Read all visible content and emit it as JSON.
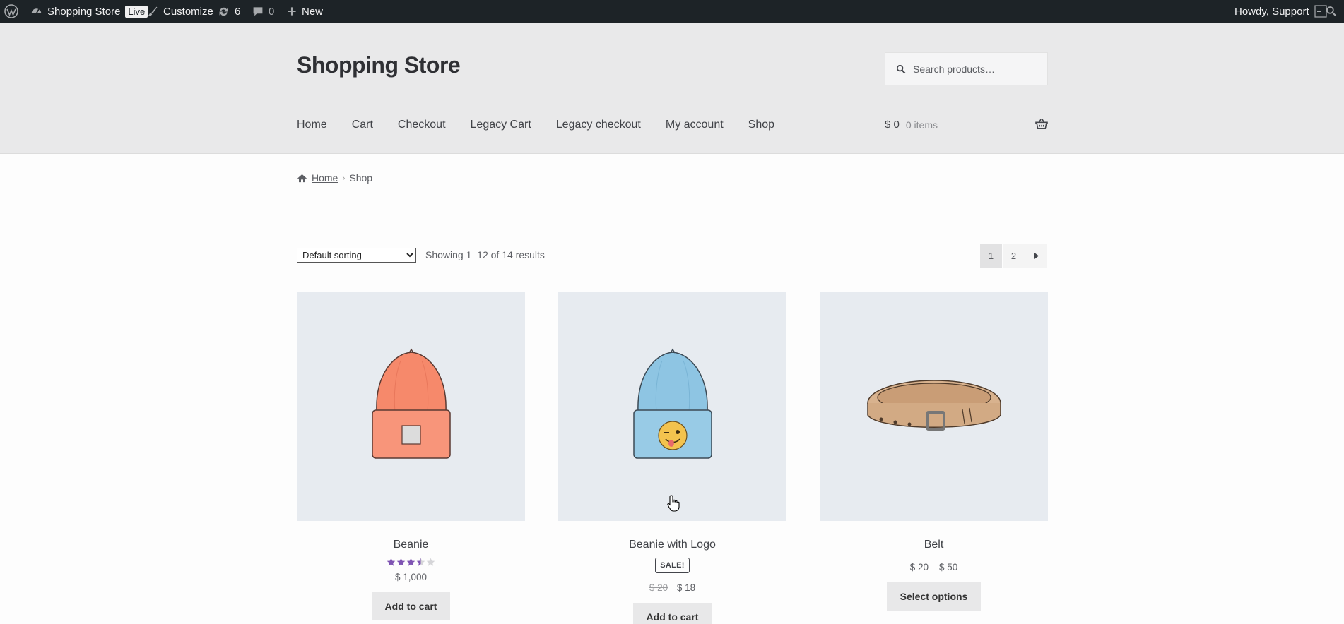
{
  "adminbar": {
    "site_name": "Shopping Store",
    "live_label": "Live",
    "customize_label": "Customize",
    "updates_count": "6",
    "comments_count": "0",
    "new_label": "New",
    "greeting": "Howdy, Support"
  },
  "header": {
    "site_title": "Shopping Store",
    "search_placeholder": "Search products…",
    "nav": [
      "Home",
      "Cart",
      "Checkout",
      "Legacy Cart",
      "Legacy checkout",
      "My account",
      "Shop"
    ],
    "cart_amount": "$ 0",
    "cart_items": "0 items"
  },
  "breadcrumb": {
    "home": "Home",
    "current": "Shop"
  },
  "shop": {
    "sorting_selected": "Default sorting",
    "result_count": "Showing 1–12 of 14 results",
    "pages": [
      "1",
      "2"
    ],
    "current_page": "1"
  },
  "products": [
    {
      "title": "Beanie",
      "rating": 3.5,
      "rating_max": 5,
      "price": "$ 1,000",
      "button": "Add to cart",
      "image": "orange-beanie-illustration"
    },
    {
      "title": "Beanie with Logo",
      "badge": "SALE!",
      "regular_price": "$ 20",
      "sale_price": "$ 18",
      "button": "Add to cart",
      "image": "blue-beanie-with-emoji-logo-illustration"
    },
    {
      "title": "Belt",
      "price": "$ 20 – $ 50",
      "button": "Select options",
      "image": "leather-belt-illustration"
    }
  ],
  "colors": {
    "adminbar_bg": "#1d2327",
    "header_bg": "#e9e9ea",
    "product_bg": "#e7ebf0",
    "star_color": "#7f54b3",
    "button_bg": "#e8e8e9"
  }
}
